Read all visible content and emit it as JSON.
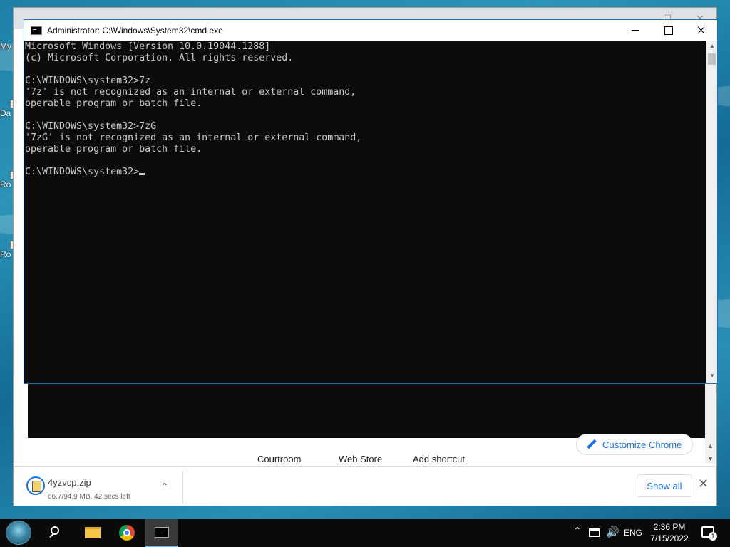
{
  "desktop": {
    "icons": [
      {
        "label": "My"
      },
      {
        "label": "Da"
      },
      {
        "label": "Ro"
      },
      {
        "label": "Ro"
      }
    ]
  },
  "chrome": {
    "shortcuts": [
      "Courtroom",
      "Web Store",
      "Add shortcut"
    ],
    "customize_label": "Customize Chrome",
    "download": {
      "filename": "4yzvcp.zip",
      "status": "66.7/94.9 MB, 42 secs left",
      "progress_mb": 66.7,
      "total_mb": 94.9
    },
    "show_all_label": "Show all"
  },
  "cmd": {
    "title": "Administrator: C:\\Windows\\System32\\cmd.exe",
    "lines": [
      "Microsoft Windows [Version 10.0.19044.1288]",
      "(c) Microsoft Corporation. All rights reserved.",
      "",
      "C:\\WINDOWS\\system32>7z",
      "'7z' is not recognized as an internal or external command,",
      "operable program or batch file.",
      "",
      "C:\\WINDOWS\\system32>7zG",
      "'7zG' is not recognized as an internal or external command,",
      "operable program or batch file.",
      "",
      "C:\\WINDOWS\\system32>"
    ]
  },
  "taskbar": {
    "language": "ENG",
    "time": "2:36 PM",
    "date": "7/15/2022",
    "notification_count": "1",
    "icons": [
      "start-icon",
      "search-icon",
      "file-explorer-icon",
      "chrome-icon",
      "cmd-icon"
    ]
  }
}
